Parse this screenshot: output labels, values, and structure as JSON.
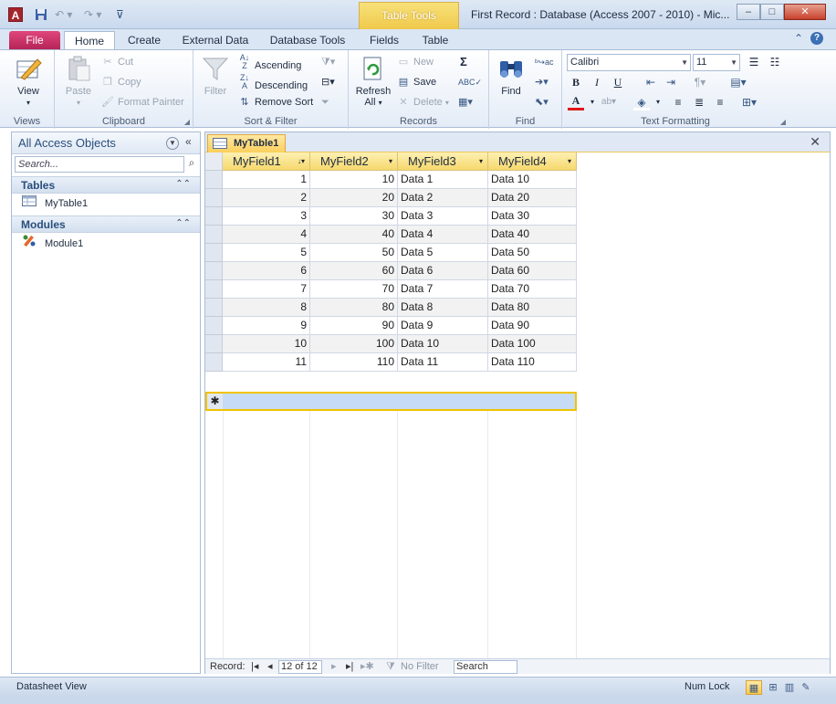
{
  "window": {
    "app_icon": "A",
    "title": "First Record : Database (Access 2007 - 2010)  -  Mic...",
    "context_group": "Table Tools",
    "minimize": "–",
    "maximize": "□",
    "close": "✕"
  },
  "qat": {
    "save_icon": "save-icon",
    "undo_icon": "undo-icon",
    "redo_icon": "redo-icon",
    "customize_icon": "customize-qat-icon"
  },
  "tabs": {
    "file": "File",
    "home": "Home",
    "create": "Create",
    "external": "External Data",
    "dbtools": "Database Tools",
    "fields": "Fields",
    "table": "Table"
  },
  "ribbon": {
    "views": {
      "label": "Views",
      "view": "View"
    },
    "clipboard": {
      "label": "Clipboard",
      "paste": "Paste",
      "cut": "Cut",
      "copy": "Copy",
      "format_painter": "Format Painter"
    },
    "sort_filter": {
      "label": "Sort & Filter",
      "filter": "Filter",
      "ascending": "Ascending",
      "descending": "Descending",
      "remove_sort": "Remove Sort"
    },
    "records": {
      "label": "Records",
      "refresh": "Refresh",
      "refresh_all": "All",
      "new": "New",
      "save": "Save",
      "delete": "Delete"
    },
    "find": {
      "label": "Find",
      "find": "Find"
    },
    "text_formatting": {
      "label": "Text Formatting",
      "font": "Calibri",
      "size": "11",
      "bold": "B",
      "italic": "I",
      "underline": "U",
      "font_color": "A"
    }
  },
  "nav": {
    "title": "All Access Objects",
    "search_placeholder": "Search...",
    "groups": [
      {
        "label": "Tables",
        "items": [
          "MyTable1"
        ]
      },
      {
        "label": "Modules",
        "items": [
          "Module1"
        ]
      }
    ]
  },
  "doc": {
    "tab": "MyTable1",
    "columns": [
      "MyField1",
      "MyField2",
      "MyField3",
      "MyField4"
    ],
    "rows": [
      [
        "1",
        "10",
        "Data 1",
        "Data 10"
      ],
      [
        "2",
        "20",
        "Data 2",
        "Data 20"
      ],
      [
        "3",
        "30",
        "Data 3",
        "Data 30"
      ],
      [
        "4",
        "40",
        "Data 4",
        "Data 40"
      ],
      [
        "5",
        "50",
        "Data 5",
        "Data 50"
      ],
      [
        "6",
        "60",
        "Data 6",
        "Data 60"
      ],
      [
        "7",
        "70",
        "Data 7",
        "Data 70"
      ],
      [
        "8",
        "80",
        "Data 8",
        "Data 80"
      ],
      [
        "9",
        "90",
        "Data 9",
        "Data 90"
      ],
      [
        "10",
        "100",
        "Data 10",
        "Data 100"
      ],
      [
        "11",
        "110",
        "Data 11",
        "Data 110"
      ]
    ],
    "new_row_marker": "✱"
  },
  "recnav": {
    "label": "Record:",
    "current": "12 of 12",
    "filter": "No Filter",
    "search": "Search"
  },
  "status": {
    "text": "Datasheet View",
    "numlock": "Num Lock"
  },
  "colors": {
    "accent": "#f6d86c",
    "file_tab": "#b52457",
    "selection": "#c6dcf6"
  }
}
